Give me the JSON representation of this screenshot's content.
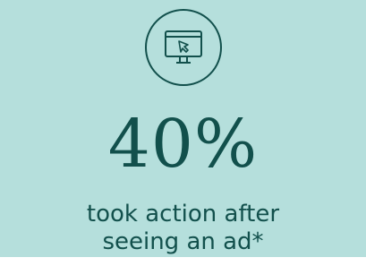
{
  "colors": {
    "background": "#b5dfdc",
    "accent": "#12504c",
    "bottom_strip": "#ffffff"
  },
  "icon": {
    "name": "monitor-cursor-icon"
  },
  "stat": {
    "value": "40%"
  },
  "caption": {
    "line1": "took action after",
    "line2": "seeing an ad*"
  }
}
